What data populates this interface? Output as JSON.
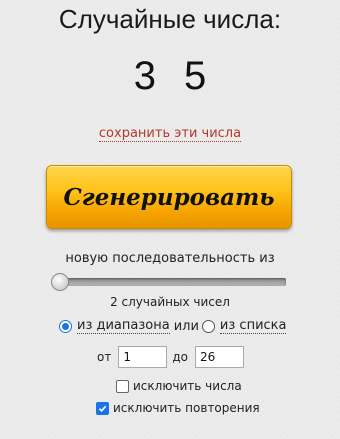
{
  "header": {
    "title": "Случайные числа:"
  },
  "results": {
    "numbers": [
      "3",
      "5"
    ]
  },
  "save_link": "сохранить эти числа",
  "generate_button": "Сгенерировать",
  "sequence": {
    "label": "новую последовательность из",
    "slider_value": 2,
    "count_text": "2 случайных чисел"
  },
  "source": {
    "range_option": "из диапазона",
    "or_text": "или",
    "list_option": "из списка",
    "selected": "range"
  },
  "range": {
    "from_label": "от",
    "from_value": "1",
    "to_label": "до",
    "to_value": "26"
  },
  "options": {
    "exclude_numbers": {
      "label": "исключить числа",
      "checked": false
    },
    "exclude_repeats": {
      "label": "исключить повторения",
      "checked": true
    }
  },
  "colors": {
    "button_top": "#ffd54a",
    "button_bottom": "#e69500",
    "link": "#b33a2a",
    "accent": "#1a73e8"
  }
}
